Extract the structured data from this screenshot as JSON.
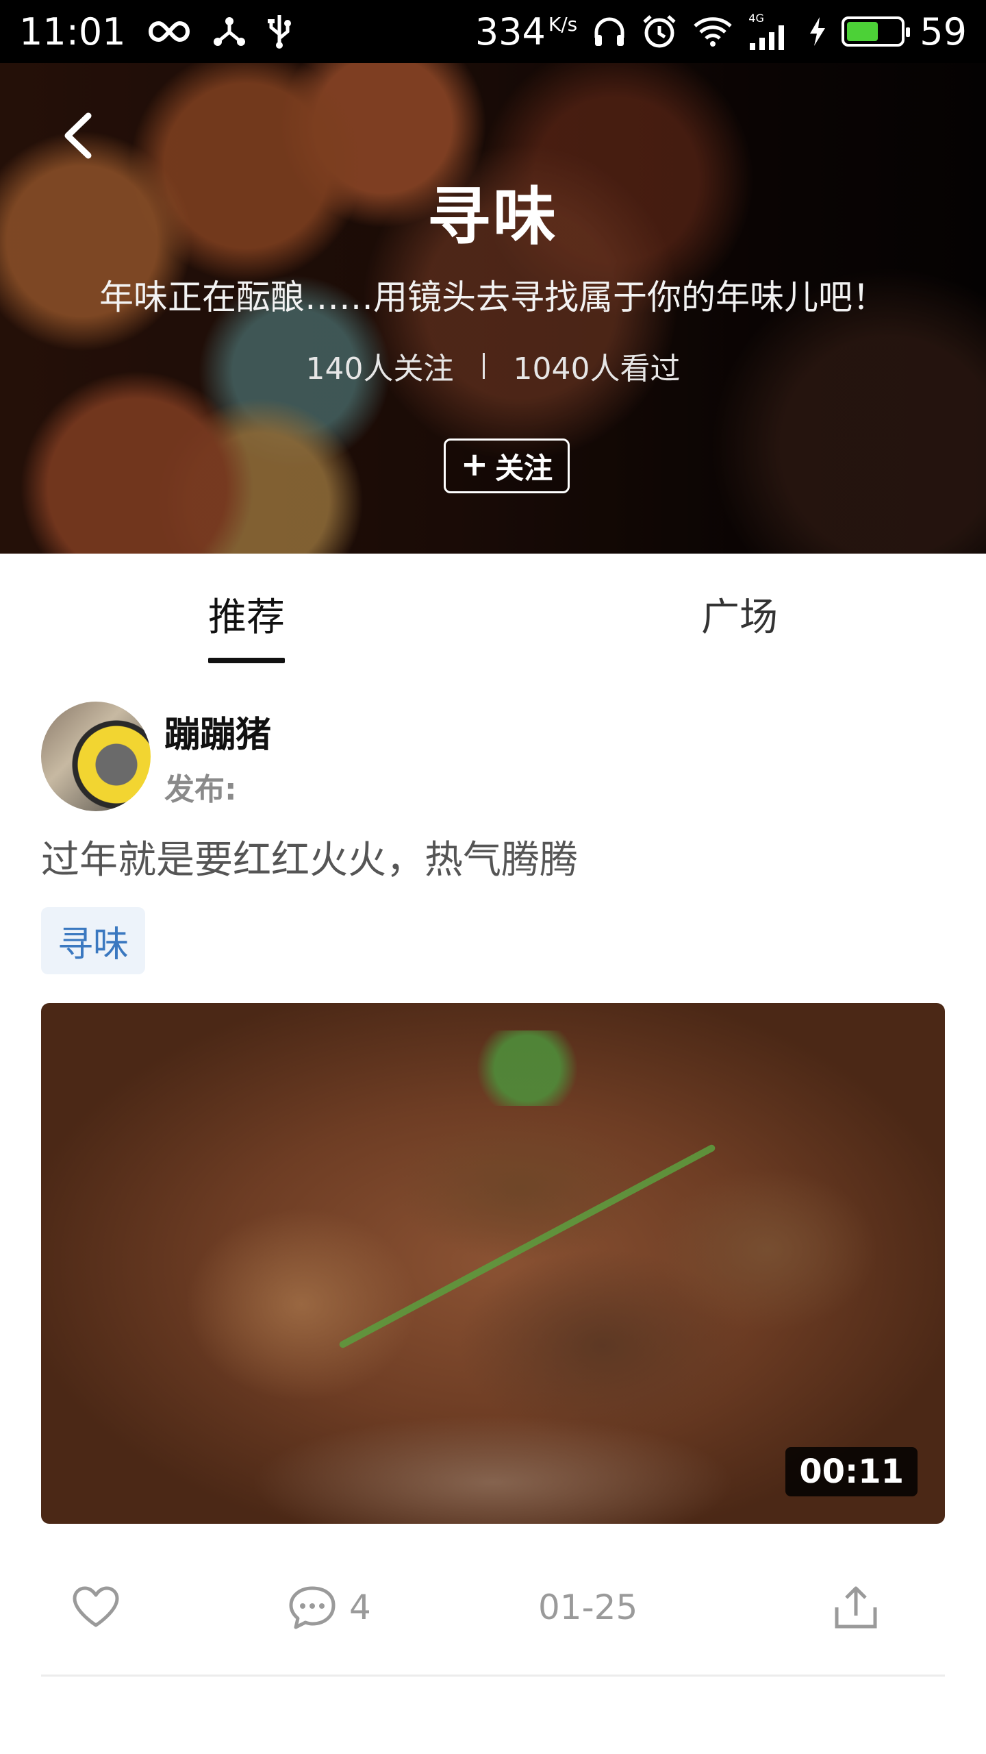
{
  "status_bar": {
    "time": "11:01",
    "net_speed": "334",
    "net_speed_unit": "K/s",
    "network_type": "4G",
    "battery": "59",
    "battery_level": 0.59,
    "icons": [
      "infinity-icon",
      "share-icon",
      "usb-icon",
      "headphones-icon",
      "alarm-icon",
      "wifi-icon",
      "signal-icon",
      "charging-icon",
      "battery-icon"
    ]
  },
  "header": {
    "title": "寻味",
    "description": "年味正在酝酿……用镜头去寻找属于你的年味儿吧！",
    "followers": "140人关注",
    "views": "1040人看过",
    "follow_label": "关注"
  },
  "tabs": [
    {
      "label": "推荐",
      "active": true
    },
    {
      "label": "广场",
      "active": false
    }
  ],
  "post": {
    "author": "蹦蹦猪",
    "meta": "发布:",
    "text": "过年就是要红红火火，热气腾腾",
    "tag": "寻味",
    "video_duration": "00:11",
    "comments": "4",
    "date": "01-25"
  },
  "colors": {
    "tag_text": "#3a78c0",
    "tag_bg": "#edf3fa",
    "battery_green": "#4cd137"
  }
}
